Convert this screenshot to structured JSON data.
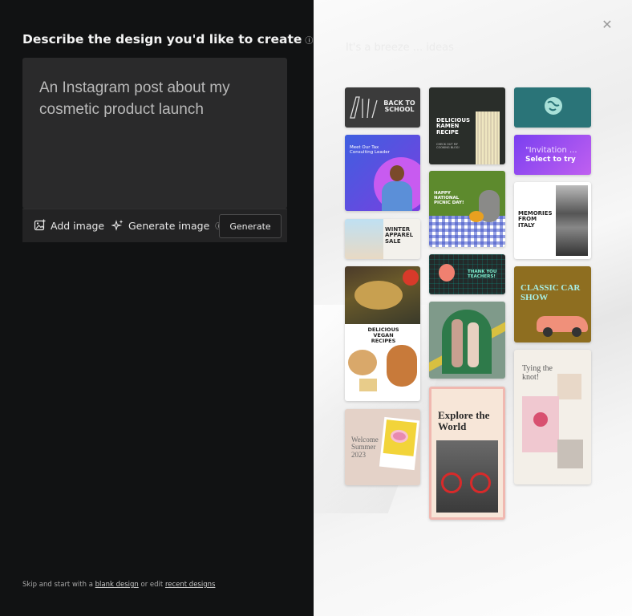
{
  "left": {
    "heading": "Describe the design you'd like to create",
    "heading_info": "ⓘ",
    "prompt": "An Instagram post about my cosmetic product launch",
    "add_image": "Add image",
    "generate_image": "Generate image",
    "generate_image_info": "ⓘ",
    "generate_button": "Generate",
    "footer": {
      "prefix": "Skip and start with a",
      "blank_design": "blank design",
      "middle": "or edit",
      "recent_designs": "recent designs"
    }
  },
  "right": {
    "close_icon": "✕",
    "ghost_text": "It's a breeze ... ideas"
  },
  "templates": {
    "back_to_school": "BACK TO SCHOOL",
    "ramen_title": "DELICIOUS RAMEN RECIPE",
    "ramen_sub": "CHECK OUT MY COOKING BLOG!",
    "meet_our_tax": "Meet Our Tax Consulting Leader",
    "invitation": "\"Invitation ...",
    "select_to_try": "Select to try",
    "picnic": "HAPPY NATIONAL PICNIC DAY!",
    "memories": "MEMORIES FROM ITALY",
    "winter_sale": "WINTER APPAREL SALE",
    "thank_teachers": "THANK YOU TEACHERS!",
    "classic_car": "CLASSIC CAR SHOW",
    "vegan": "DELICIOUS VEGAN RECIPES",
    "explore": "Explore the World",
    "tying_knot": "Tying the knot!",
    "welcome_summer": "Welcome Summer 2023"
  }
}
